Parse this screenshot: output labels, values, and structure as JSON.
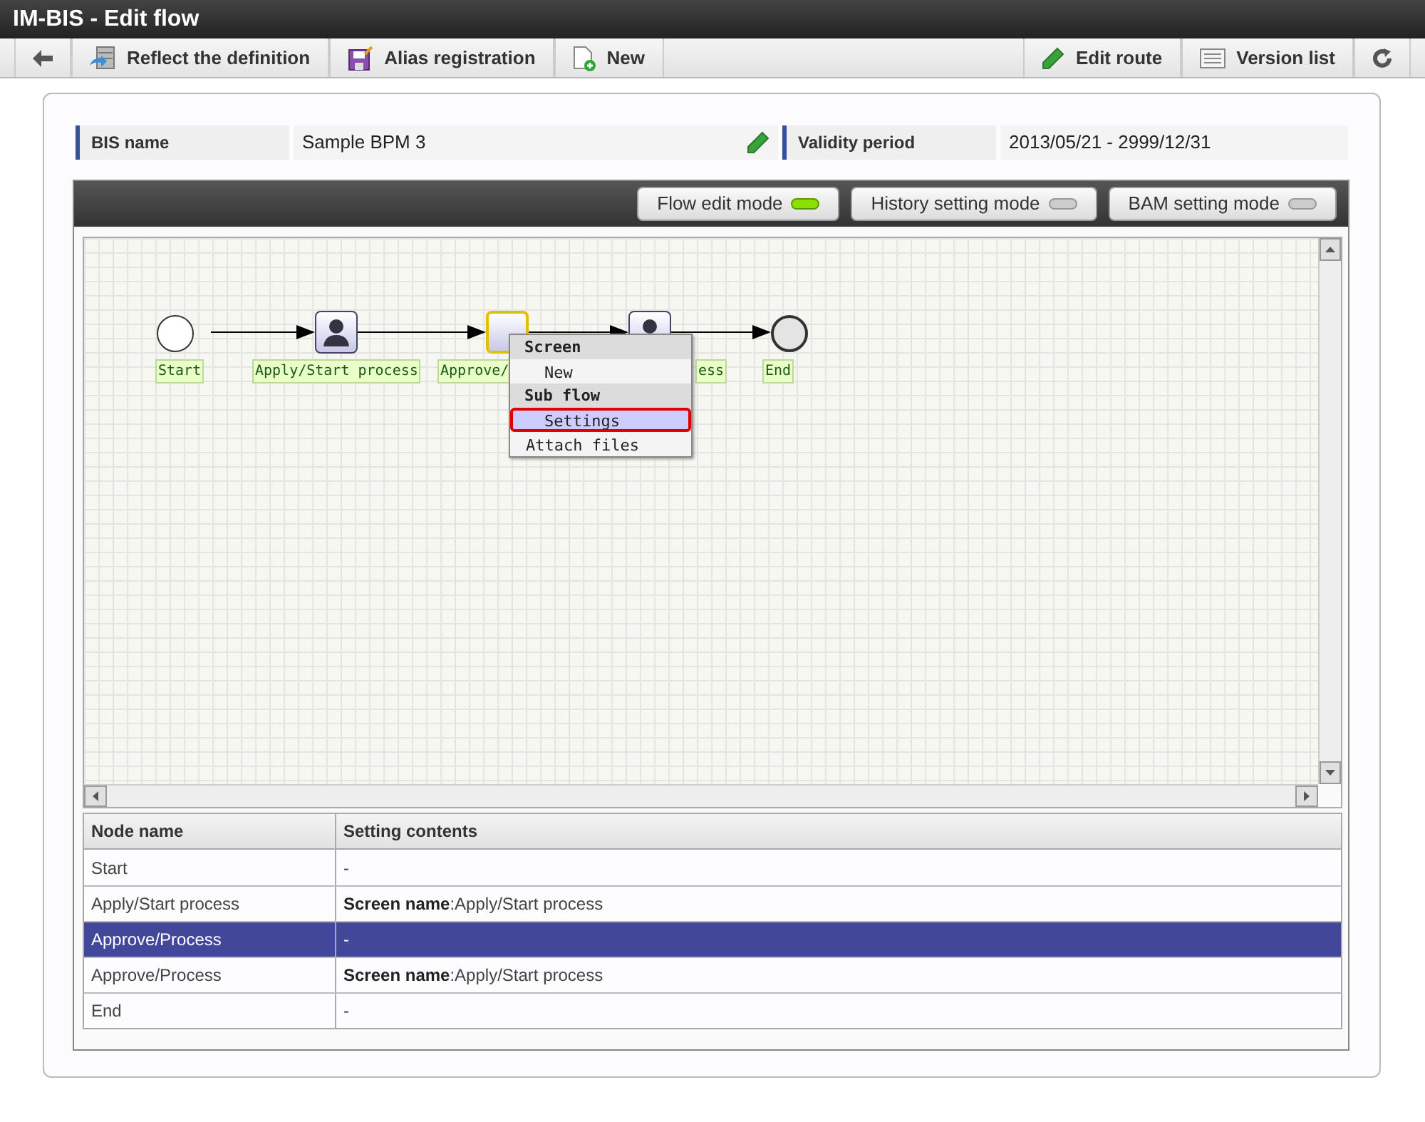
{
  "window": {
    "title": "IM-BIS - Edit flow"
  },
  "toolbar": {
    "left": [
      {
        "kind": "back"
      },
      {
        "kind": "reflect",
        "label": "Reflect the definition"
      },
      {
        "kind": "alias",
        "label": "Alias registration"
      },
      {
        "kind": "new",
        "label": "New"
      }
    ],
    "right": [
      {
        "kind": "edit",
        "label": "Edit route"
      },
      {
        "kind": "versions",
        "label": "Version list"
      },
      {
        "kind": "refresh"
      }
    ]
  },
  "info": [
    {
      "label": "BIS name",
      "value": "Sample BPM 3",
      "editable": true
    },
    {
      "label": "Validity period",
      "value": "2013/05/21  -  2999/12/31",
      "editable": false
    }
  ],
  "modes": [
    {
      "label": "Flow edit mode",
      "selected": true
    },
    {
      "label": "History setting mode",
      "selected": false
    },
    {
      "label": "BAM setting mode",
      "selected": false
    }
  ],
  "flow": {
    "nodes": [
      {
        "kind": "start",
        "label": "Start"
      },
      {
        "kind": "task",
        "label": "Apply/Start process",
        "selected": false
      },
      {
        "kind": "task",
        "label": "Approve/",
        "selected": true
      },
      {
        "kind": "task",
        "label": "ess",
        "selected": false
      },
      {
        "kind": "end",
        "label": "End"
      }
    ],
    "menu": [
      {
        "kind": "header",
        "label": "Screen"
      },
      {
        "kind": "item",
        "label": "New",
        "selected": false
      },
      {
        "kind": "header",
        "label": "Sub flow"
      },
      {
        "kind": "item",
        "label": "Settings",
        "selected": true
      },
      {
        "kind": "plain",
        "label": "Attach files",
        "selected": false
      }
    ]
  },
  "table": {
    "columns": [
      "Node name",
      "Setting contents"
    ],
    "rows": [
      {
        "node": "Start",
        "setting": "-",
        "selected": false
      },
      {
        "node": "Apply/Start process",
        "setting": "**Screen name**:Apply/Start process",
        "selected": false
      },
      {
        "node": "Approve/Process",
        "setting": "-",
        "selected": true
      },
      {
        "node": "Approve/Process",
        "setting": "**Screen name**:Apply/Start process",
        "selected": false
      },
      {
        "node": "End",
        "setting": "-",
        "selected": false
      }
    ]
  }
}
